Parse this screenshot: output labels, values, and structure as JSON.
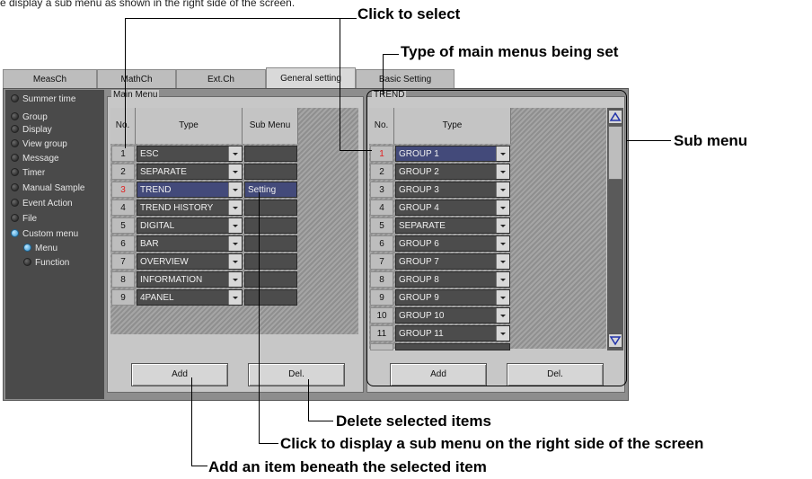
{
  "top_line_text": "e display a sub menu as shown in the right side of the screen.",
  "callouts": {
    "click_to_select": "Click to select",
    "type_of_main_menus": "Type of main menus being set",
    "sub_menu": "Sub menu",
    "delete_selected": "Delete selected items",
    "click_to_display": "Click to display a sub menu on the right side of the screen",
    "add_item": "Add an item beneath the selected item"
  },
  "tabs": [
    {
      "label": "MeasCh"
    },
    {
      "label": "MathCh"
    },
    {
      "label": "Ext.Ch"
    },
    {
      "label": "General setting"
    },
    {
      "label": "Basic Setting"
    }
  ],
  "sidebar": {
    "items": [
      {
        "label": "Summer time",
        "active": false
      },
      {
        "label": "Group",
        "active": false
      },
      {
        "label": "Display",
        "active": false
      },
      {
        "label": "View group",
        "active": false
      },
      {
        "label": "Message",
        "active": false
      },
      {
        "label": "Timer",
        "active": false
      },
      {
        "label": "Manual Sample",
        "active": false
      },
      {
        "label": "Event Action",
        "active": false
      },
      {
        "label": "File",
        "active": false
      },
      {
        "label": "Custom menu",
        "active": true
      },
      {
        "label": "Menu",
        "active": true
      },
      {
        "label": "Function",
        "active": false
      }
    ]
  },
  "main_menu": {
    "title": "Main Menu",
    "headers": {
      "no": "No.",
      "type": "Type",
      "sub": "Sub Menu"
    },
    "rows": [
      {
        "no": "1",
        "type": "ESC",
        "sub": ""
      },
      {
        "no": "2",
        "type": "SEPARATE",
        "sub": ""
      },
      {
        "no": "3",
        "type": "TREND",
        "sub": "Setting"
      },
      {
        "no": "4",
        "type": "TREND HISTORY",
        "sub": ""
      },
      {
        "no": "5",
        "type": "DIGITAL",
        "sub": ""
      },
      {
        "no": "6",
        "type": "BAR",
        "sub": ""
      },
      {
        "no": "7",
        "type": "OVERVIEW",
        "sub": ""
      },
      {
        "no": "8",
        "type": "INFORMATION",
        "sub": ""
      },
      {
        "no": "9",
        "type": "4PANEL",
        "sub": ""
      }
    ],
    "selected_row": "3",
    "add_label": "Add",
    "del_label": "Del."
  },
  "sub_menu": {
    "title": "TREND",
    "headers": {
      "no": "No.",
      "type": "Type"
    },
    "rows": [
      {
        "no": "1",
        "type": "GROUP 1"
      },
      {
        "no": "2",
        "type": "GROUP 2"
      },
      {
        "no": "3",
        "type": "GROUP 3"
      },
      {
        "no": "4",
        "type": "GROUP 4"
      },
      {
        "no": "5",
        "type": "SEPARATE"
      },
      {
        "no": "6",
        "type": "GROUP 6"
      },
      {
        "no": "7",
        "type": "GROUP 7"
      },
      {
        "no": "8",
        "type": "GROUP 8"
      },
      {
        "no": "9",
        "type": "GROUP 9"
      },
      {
        "no": "10",
        "type": "GROUP 10"
      },
      {
        "no": "11",
        "type": "GROUP 11"
      }
    ],
    "selected_row": "1",
    "add_label": "Add",
    "del_label": "Del."
  },
  "colors": {
    "selected_row_number": "#e02020",
    "selected_cell": "#434a7a",
    "sidebar_bg": "#4a4a4a",
    "active_bullet": "#2a8fcf"
  }
}
